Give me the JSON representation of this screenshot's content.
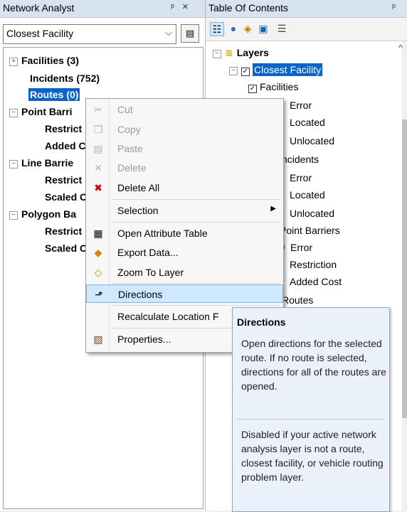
{
  "left_panel": {
    "title": "Network Analyst",
    "pin": "ᵖ",
    "close": "×",
    "combo_value": "Closest Facility",
    "tree": [
      {
        "label": "Facilities (3)",
        "expander": "+"
      },
      {
        "label": "Incidents (752)"
      },
      {
        "label": "Routes (0)"
      },
      {
        "label": "Point Barri",
        "expander": "−"
      },
      {
        "label": "Restrict"
      },
      {
        "label": "Added C"
      },
      {
        "label": "Line Barrie",
        "expander": "−"
      },
      {
        "label": "Restrict"
      },
      {
        "label": "Scaled C"
      },
      {
        "label": "Polygon Ba",
        "expander": "−"
      },
      {
        "label": "Restrict"
      },
      {
        "label": "Scaled C"
      }
    ]
  },
  "right_panel": {
    "title": "Table Of Contents",
    "pin": "ᵖ",
    "close": "×",
    "toc": [
      {
        "label": "Layers"
      },
      {
        "label": "Closest Facility"
      },
      {
        "label": "Facilities"
      },
      {
        "label": "Error"
      },
      {
        "label": "Located"
      },
      {
        "label": "Unlocated"
      },
      {
        "label": "ncidents"
      },
      {
        "label": "Error"
      },
      {
        "label": "Located"
      },
      {
        "label": "Unlocated"
      },
      {
        "label": "Point Barriers"
      },
      {
        "label": "Error"
      },
      {
        "label": "Restriction"
      },
      {
        "label": "Added Cost"
      },
      {
        "label": "Routes"
      }
    ]
  },
  "context_menu": {
    "items": [
      {
        "label": "Cut",
        "icon": "scissors-icon",
        "enabled": false
      },
      {
        "label": "Copy",
        "icon": "copy-icon",
        "enabled": false
      },
      {
        "label": "Paste",
        "icon": "paste-icon",
        "enabled": false
      },
      {
        "label": "Delete",
        "icon": "delete-icon",
        "enabled": false
      },
      {
        "label": "Delete All",
        "icon": "delete-all-icon",
        "enabled": true
      },
      {
        "label": "Selection",
        "icon": "",
        "enabled": true,
        "submenu": true
      },
      {
        "label": "Open Attribute Table",
        "icon": "table-icon",
        "enabled": true
      },
      {
        "label": "Export Data...",
        "icon": "export-icon",
        "enabled": true
      },
      {
        "label": "Zoom To Layer",
        "icon": "zoom-layer-icon",
        "enabled": true
      },
      {
        "label": "Directions",
        "icon": "directions-icon",
        "enabled": true,
        "highlighted": true
      },
      {
        "label": "Recalculate Location F",
        "icon": "",
        "enabled": true
      },
      {
        "label": "Properties...",
        "icon": "properties-icon",
        "enabled": true
      }
    ]
  },
  "tooltip": {
    "title": "Directions",
    "body": "Open directions for the selected route. If no route is selected, directions for all of the routes are opened.",
    "body2": "Disabled if your active network analysis layer is not a route, closest facility, or vehicle routing problem layer."
  },
  "colors": {
    "selection": "#0a64c8",
    "menu_highlight": "#cde8ff",
    "tooltip_bg": "#eaf1fb",
    "error_red": "#e00000",
    "located_purple": "#6a0dad",
    "unlocated_lilac": "#e8d0f4"
  }
}
